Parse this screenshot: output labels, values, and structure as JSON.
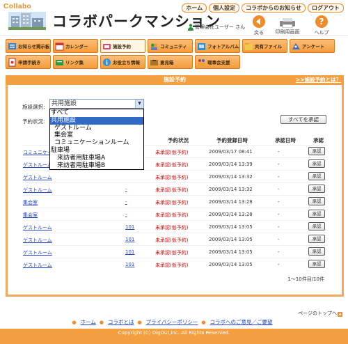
{
  "brand": "Collabo",
  "site_title": "コラボパークマンション",
  "top_nav": [
    "ホーム",
    "個人設定",
    "コラボからのお知らせ",
    "ログアウト"
  ],
  "user_info": "管理会社ユーザー さん",
  "header_buttons": {
    "back": "戻る",
    "print": "印刷用画面",
    "help": "ヘルプ"
  },
  "menu": {
    "row1": [
      {
        "label": "お知らせ掲示板",
        "icon": "bulletin-icon"
      },
      {
        "label": "カレンダー",
        "icon": "calendar-icon"
      },
      {
        "label": "施設予約",
        "icon": "reservation-icon"
      },
      {
        "label": "コミュニティ",
        "icon": "community-icon"
      },
      {
        "label": "フォトアルバム",
        "icon": "photo-album-icon"
      },
      {
        "label": "共有ファイル",
        "icon": "shared-file-icon"
      },
      {
        "label": "アンケート",
        "icon": "survey-icon"
      }
    ],
    "row2": [
      {
        "label": "申請手続き",
        "icon": "application-icon"
      },
      {
        "label": "リンク集",
        "icon": "link-icon"
      },
      {
        "label": "お役立ち情報",
        "icon": "info-icon"
      },
      {
        "label": "意見箱",
        "icon": "opinion-box-icon"
      },
      {
        "label": "理事会支援",
        "icon": "board-support-icon"
      }
    ]
  },
  "panel": {
    "title": "施設予約",
    "help_link": ">>施設予約とは？"
  },
  "form": {
    "facility_label": "施設選択:",
    "facility_selected": "共用施設",
    "status_label": "予約状況:",
    "approve_all": "すべてを承認"
  },
  "dropdown_options": [
    {
      "label": "すべて",
      "indent": 0,
      "selected": false
    },
    {
      "label": "共用施設",
      "indent": 0,
      "selected": true
    },
    {
      "label": "ゲストルーム",
      "indent": 1,
      "selected": false
    },
    {
      "label": "集会室",
      "indent": 1,
      "selected": false
    },
    {
      "label": "コミュニケーションルーム",
      "indent": 1,
      "selected": false
    },
    {
      "label": "駐車場",
      "indent": 0,
      "selected": false
    },
    {
      "label": "来訪者用駐車場A",
      "indent": 2,
      "selected": false
    },
    {
      "label": "来訪者用駐車場B",
      "indent": 2,
      "selected": false
    }
  ],
  "table": {
    "columns": [
      "予約状況",
      "予約登録日時",
      "承認日時",
      "承認"
    ],
    "rows": [
      {
        "facility": "コミュニケーションルーム",
        "room": "",
        "status": "未承認(仮予約)",
        "registered": "2009/03/17 08:41",
        "approved": "-",
        "button": "承認"
      },
      {
        "facility": "ゲストルーム",
        "room": "",
        "status": "未承認(仮予約)",
        "registered": "2009/03/14 13:39",
        "approved": "-",
        "button": "承認"
      },
      {
        "facility": "ゲストルーム",
        "room": "",
        "status": "未承認(仮予約)",
        "registered": "2009/03/14 13:32",
        "approved": "-",
        "button": "承認"
      },
      {
        "facility": "ゲストルーム",
        "room": "-",
        "status": "未承認(仮予約)",
        "registered": "2009/03/14 13:32",
        "approved": "-",
        "button": "承認"
      },
      {
        "facility": "集会室",
        "room": "-",
        "status": "未承認(仮予約)",
        "registered": "2009/03/14 13:28",
        "approved": "-",
        "button": "承認"
      },
      {
        "facility": "集会室",
        "room": "-",
        "status": "未承認(仮予約)",
        "registered": "2009/03/14 13:28",
        "approved": "-",
        "button": "承認"
      },
      {
        "facility": "ゲストルーム",
        "room": "101",
        "status": "未承認(仮予約)",
        "registered": "2009/03/14 13:05",
        "approved": "-",
        "button": "承認"
      },
      {
        "facility": "ゲストルーム",
        "room": "101",
        "status": "未承認(仮予約)",
        "registered": "2009/03/14 13:05",
        "approved": "-",
        "button": "承認"
      },
      {
        "facility": "ゲストルーム",
        "room": "101",
        "status": "未承認(仮予約)",
        "registered": "2009/03/14 13:05",
        "approved": "-",
        "button": "承認"
      },
      {
        "facility": "ゲストルーム",
        "room": "101",
        "status": "未承認(仮予約)",
        "registered": "2009/03/14 13:05",
        "approved": "-",
        "button": "承認"
      }
    ]
  },
  "page_count": "1〜10件目/10件",
  "page_top": "ページのトップへ",
  "footer_links": [
    "ホーム",
    "コラボとは",
    "プライバシーポリシー",
    "コラボへのご意見／ご要望"
  ],
  "copyright": "Copyright (C) DigOut,Inc. All Rights Reserved."
}
